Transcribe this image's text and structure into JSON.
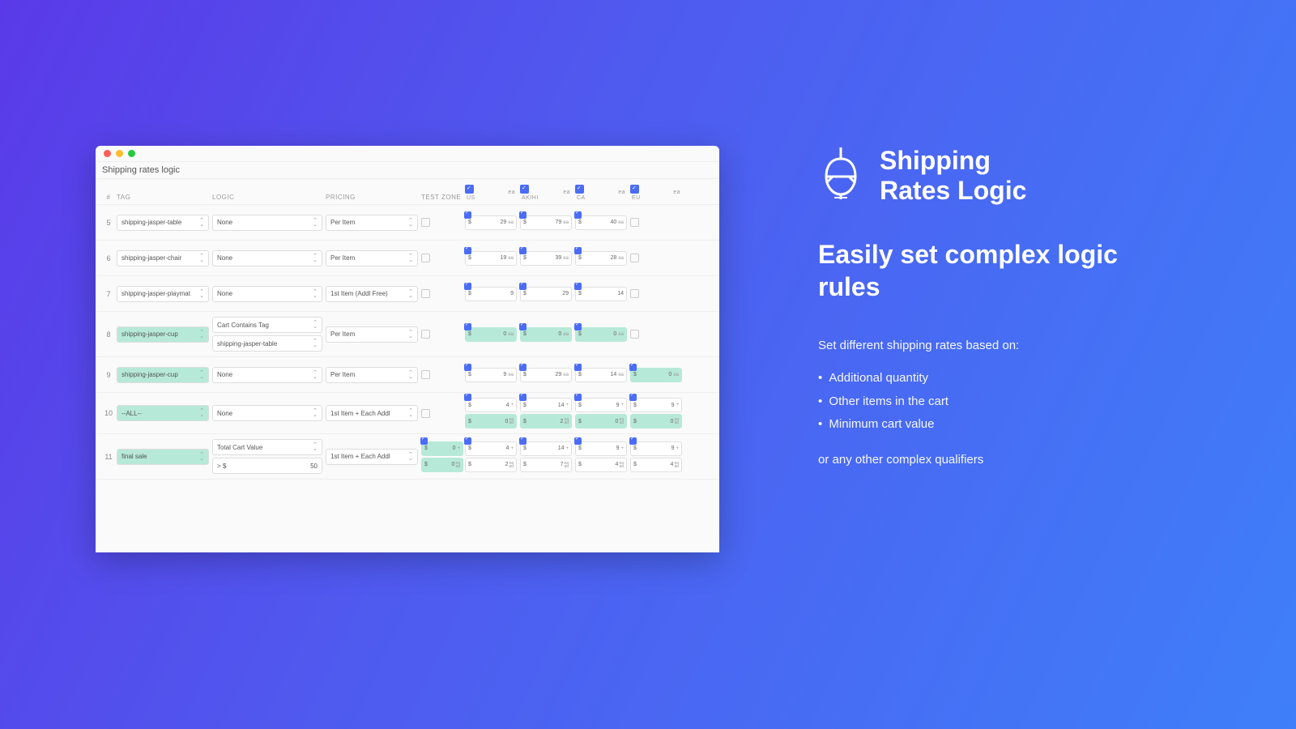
{
  "window_title": "Shipping rates logic",
  "headers": {
    "num": "#",
    "tag": "TAG",
    "logic": "LOGIC",
    "pricing": "PRICING",
    "test": "TEST ZONE"
  },
  "zones": [
    {
      "label": "US",
      "checked": true,
      "ea": "ea"
    },
    {
      "label": "AK/HI",
      "checked": true,
      "ea": "ea"
    },
    {
      "label": "CA",
      "checked": true,
      "ea": "ea"
    },
    {
      "label": "EU",
      "checked": true,
      "ea": "ea"
    }
  ],
  "rows": [
    {
      "num": "5",
      "tag": "shipping-jasper-table",
      "tag_hl": false,
      "logic": [
        {
          "v": "None",
          "type": "sel"
        }
      ],
      "pricing": "Per Item",
      "test": false,
      "cells": [
        {
          "stack": [
            {
              "v": "29",
              "u": "ea",
              "chk": true
            }
          ]
        },
        {
          "stack": [
            {
              "v": "79",
              "u": "ea",
              "chk": true
            }
          ]
        },
        {
          "stack": [
            {
              "v": "40",
              "u": "ea",
              "chk": true
            }
          ]
        },
        {
          "empty": true
        }
      ]
    },
    {
      "num": "6",
      "tag": "shipping-jasper-chair",
      "tag_hl": false,
      "logic": [
        {
          "v": "None",
          "type": "sel"
        }
      ],
      "pricing": "Per Item",
      "test": false,
      "cells": [
        {
          "stack": [
            {
              "v": "19",
              "u": "ea",
              "chk": true
            }
          ]
        },
        {
          "stack": [
            {
              "v": "39",
              "u": "ea",
              "chk": true
            }
          ]
        },
        {
          "stack": [
            {
              "v": "28",
              "u": "ea",
              "chk": true
            }
          ]
        },
        {
          "empty": true
        }
      ]
    },
    {
      "num": "7",
      "tag": "shipping-jasper-playmat",
      "tag_hl": false,
      "logic": [
        {
          "v": "None",
          "type": "sel"
        }
      ],
      "pricing": "1st Item (Addl Free)",
      "test": false,
      "cells": [
        {
          "stack": [
            {
              "v": "9",
              "u": "",
              "chk": true
            }
          ]
        },
        {
          "stack": [
            {
              "v": "29",
              "u": "",
              "chk": true
            }
          ]
        },
        {
          "stack": [
            {
              "v": "14",
              "u": "",
              "chk": true
            }
          ]
        },
        {
          "empty": true
        }
      ]
    },
    {
      "num": "8",
      "tag": "shipping-jasper-cup",
      "tag_hl": true,
      "logic": [
        {
          "v": "Cart Contains Tag",
          "type": "sel"
        },
        {
          "v": "shipping-jasper-table",
          "type": "sel"
        }
      ],
      "pricing": "Per Item",
      "test": false,
      "cells": [
        {
          "stack": [
            {
              "v": "0",
              "u": "ea",
              "chk": true,
              "hl": true
            }
          ]
        },
        {
          "stack": [
            {
              "v": "0",
              "u": "ea",
              "chk": true,
              "hl": true
            }
          ]
        },
        {
          "stack": [
            {
              "v": "0",
              "u": "ea",
              "chk": true,
              "hl": true
            }
          ]
        },
        {
          "empty": true
        }
      ]
    },
    {
      "num": "9",
      "tag": "shipping-jasper-cup",
      "tag_hl": true,
      "logic": [
        {
          "v": "None",
          "type": "sel"
        }
      ],
      "pricing": "Per Item",
      "test": false,
      "cells": [
        {
          "stack": [
            {
              "v": "9",
              "u": "ea",
              "chk": true
            }
          ]
        },
        {
          "stack": [
            {
              "v": "29",
              "u": "ea",
              "chk": true
            }
          ]
        },
        {
          "stack": [
            {
              "v": "14",
              "u": "ea",
              "chk": true
            }
          ]
        },
        {
          "stack": [
            {
              "v": "0",
              "u": "ea",
              "chk": true,
              "hl": true
            }
          ]
        }
      ]
    },
    {
      "num": "10",
      "tag": "--ALL--",
      "tag_hl": true,
      "logic": [
        {
          "v": "None",
          "type": "sel"
        }
      ],
      "pricing": "1st Item + Each Addl",
      "test": false,
      "cells": [
        {
          "stack": [
            {
              "v": "4",
              "u": "+",
              "chk": true
            },
            {
              "v": "0",
              "u2": "ea\nad",
              "hl": true
            }
          ]
        },
        {
          "stack": [
            {
              "v": "14",
              "u": "+",
              "chk": true
            },
            {
              "v": "2",
              "u2": "ea\nad",
              "hl": true
            }
          ]
        },
        {
          "stack": [
            {
              "v": "9",
              "u": "+",
              "chk": true
            },
            {
              "v": "0",
              "u2": "ea\nad",
              "hl": true
            }
          ]
        },
        {
          "stack": [
            {
              "v": "9",
              "u": "+",
              "chk": true
            },
            {
              "v": "0",
              "u2": "ea\nad",
              "hl": true
            }
          ]
        }
      ]
    },
    {
      "num": "11",
      "tag": "final sale",
      "tag_hl": true,
      "logic": [
        {
          "v": "Total Cart Value",
          "type": "sel"
        },
        {
          "v": "> $",
          "amt": "50",
          "type": "amt"
        }
      ],
      "pricing": "1st Item + Each Addl",
      "test_cells": {
        "stack": [
          {
            "v": "0",
            "u": "+",
            "chk": true,
            "hl": true
          },
          {
            "v": "0",
            "u2": "ea\nad",
            "hl": true
          }
        ]
      },
      "cells": [
        {
          "stack": [
            {
              "v": "4",
              "u": "+",
              "chk": true
            },
            {
              "v": "2",
              "u2": "ea\nad"
            }
          ]
        },
        {
          "stack": [
            {
              "v": "14",
              "u": "+",
              "chk": true
            },
            {
              "v": "7",
              "u2": "ea\nad"
            }
          ]
        },
        {
          "stack": [
            {
              "v": "9",
              "u": "+",
              "chk": true
            },
            {
              "v": "4",
              "u2": "ea\nad"
            }
          ]
        },
        {
          "stack": [
            {
              "v": "9",
              "u": "+",
              "chk": true
            },
            {
              "v": "4",
              "u2": "ea\nad"
            }
          ]
        }
      ]
    }
  ],
  "side": {
    "brand": "Shipping\nRates Logic",
    "headline": "Easily set complex logic rules",
    "lead": "Set different shipping rates based on:",
    "bullets": [
      "Additional quantity",
      "Other items in the cart",
      "Minimum cart value"
    ],
    "tail": "or any other complex qualifiers"
  }
}
